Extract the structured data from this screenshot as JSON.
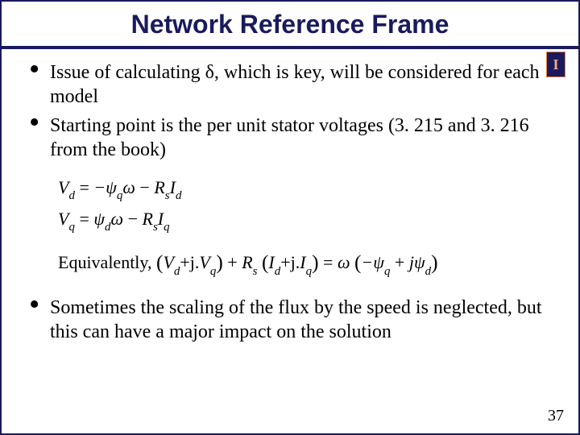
{
  "title": "Network Reference Frame",
  "logo_letter": "I",
  "bullets_top": [
    "Issue of calculating δ, which is key, will be considered for each model",
    "Starting point is the per unit stator voltages (3. 215 and 3. 216 from the book)"
  ],
  "equations": {
    "vd": {
      "lhs": "V",
      "lhs_sub": "d",
      "rhs_a": "−ψ",
      "rhs_a_sub": "q",
      "omega": "ω",
      "minus": " − ",
      "R": "R",
      "R_sub": "s",
      "I": "I",
      "I_sub": "d"
    },
    "vq": {
      "lhs": "V",
      "lhs_sub": "q",
      "rhs_a": "ψ",
      "rhs_a_sub": "d",
      "omega": "ω",
      "minus": " − ",
      "R": "R",
      "R_sub": "s",
      "I": "I",
      "I_sub": "q"
    },
    "equiv_label": "Equivalently,  ",
    "equiv": {
      "V": "V",
      "d": "d",
      "plusj": "+j.",
      "q": "q",
      "plus": " + ",
      "R": "R",
      "s": "s",
      "I": "I",
      "eq": "=",
      "omega": "ω",
      "neg_psi": "−ψ",
      "psi": "ψ",
      "j": "j"
    }
  },
  "bullets_bottom": [
    "Sometimes the scaling of the flux by the speed is neglected, but this can have a major impact on the solution"
  ],
  "page_number": "37"
}
